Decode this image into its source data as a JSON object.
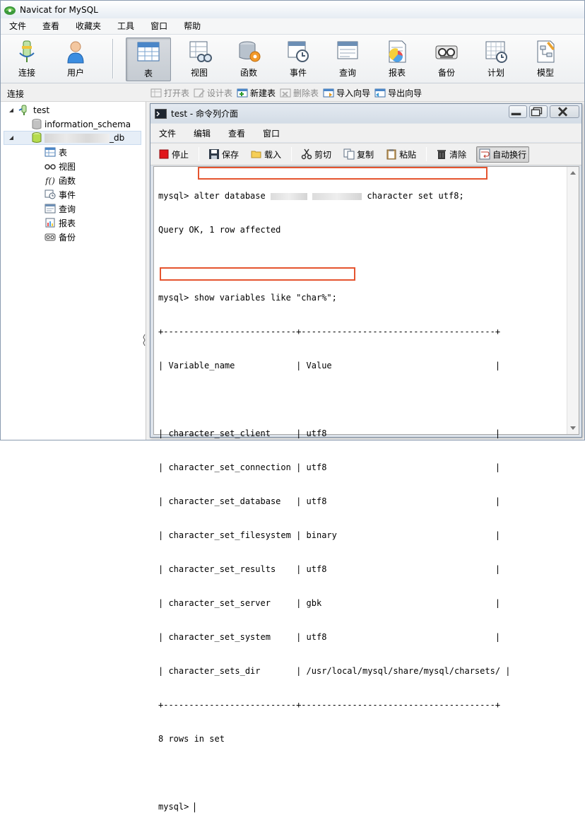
{
  "app": {
    "title": "Navicat for MySQL"
  },
  "menubar": {
    "items": [
      "文件",
      "查看",
      "收藏夹",
      "工具",
      "窗口",
      "帮助"
    ]
  },
  "toolbar": {
    "connect": "连接",
    "user": "用户",
    "table": "表",
    "view": "视图",
    "function": "函数",
    "event": "事件",
    "query": "查询",
    "report": "报表",
    "backup": "备份",
    "schedule": "计划",
    "model": "模型"
  },
  "subbar": {
    "section_label": "连接",
    "open_table": "打开表",
    "design_table": "设计表",
    "new_table": "新建表",
    "delete_table": "删除表",
    "import_wizard": "导入向导",
    "export_wizard": "导出向导"
  },
  "tree": {
    "connection": "test",
    "schema_1": "information_schema",
    "db_suffix": "_db",
    "children": [
      "表",
      "视图",
      "函数",
      "事件",
      "查询",
      "报表",
      "备份"
    ]
  },
  "console": {
    "title": "test - 命令列介面",
    "menu": [
      "文件",
      "编辑",
      "查看",
      "窗口"
    ],
    "tools": {
      "stop": "停止",
      "save": "保存",
      "load": "载入",
      "cut": "剪切",
      "copy": "复制",
      "paste": "粘贴",
      "clear": "清除",
      "wrap": "自动换行"
    },
    "cmd1_prefix": "mysql> ",
    "cmd1_a": "alter database ",
    "cmd1_b": " character set utf8;",
    "line2": "Query OK, 1 row affected",
    "line4": "mysql> show variables like \"char%\";",
    "table_border": "+--------------------------+--------------------------------------+",
    "table_header": "| Variable_name            | Value                                |",
    "table_rows": [
      "| character_set_client     | utf8                                 |",
      "| character_set_connection | utf8                                 |",
      "| character_set_database   | utf8                                 |",
      "| character_set_filesystem | binary                               |",
      "| character_set_results    | utf8                                 |",
      "| character_set_server     | gbk                                  |",
      "| character_set_system     | utf8                                 |",
      "| character_sets_dir       | /usr/local/mysql/share/mysql/charsets/ |"
    ],
    "rows_in_set": "8 rows in set",
    "prompt": "mysql> "
  },
  "colors": {
    "highlight": "#e5542f"
  }
}
